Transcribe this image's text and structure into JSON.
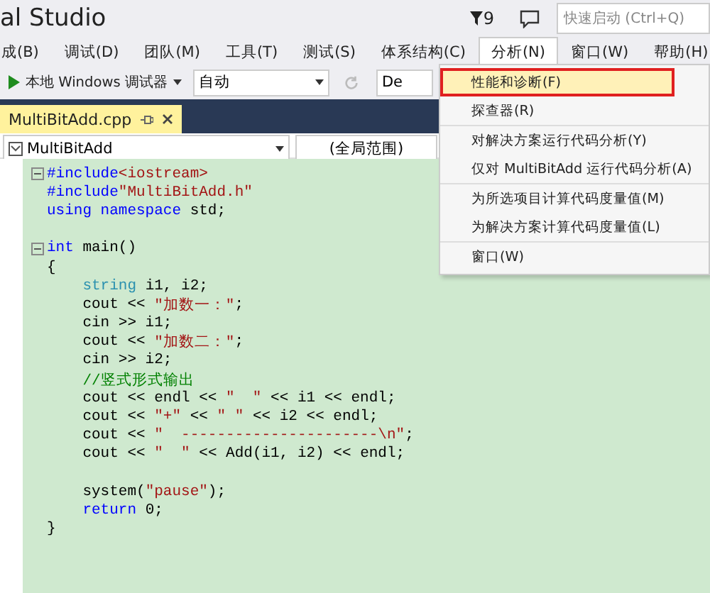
{
  "window": {
    "title": "al Studio",
    "notification_count": "9",
    "quick_launch": {
      "placeholder": "快速启动 (Ctrl+Q)"
    }
  },
  "menu_bar": [
    {
      "label": "成(B)",
      "selected": false
    },
    {
      "label": "调试(D)",
      "selected": false
    },
    {
      "label": "团队(M)",
      "selected": false
    },
    {
      "label": "工具(T)",
      "selected": false
    },
    {
      "label": "测试(S)",
      "selected": false
    },
    {
      "label": "体系结构(C)",
      "selected": false
    },
    {
      "label": "分析(N)",
      "selected": true
    },
    {
      "label": "窗口(W)",
      "selected": false
    },
    {
      "label": "帮助(H)",
      "selected": false
    }
  ],
  "toolbar": {
    "run_label": "本地 Windows 调试器",
    "config": "自动",
    "platform": "De"
  },
  "document_tab": {
    "title": "MultiBitAdd.cpp",
    "selected": true
  },
  "nav_bar": {
    "scope": "MultiBitAdd",
    "member": "(全局范围)"
  },
  "code_lines": [
    {
      "kind": "fold_start",
      "segments": [
        {
          "kind": "keyword",
          "text": "#include"
        },
        {
          "kind": "string",
          "text": "<iostream>"
        }
      ]
    },
    {
      "kind": "code",
      "segments": [
        {
          "kind": "keyword",
          "text": "#include"
        },
        {
          "kind": "string",
          "text": "\"MultiBitAdd.h\""
        }
      ]
    },
    {
      "kind": "code",
      "segments": [
        {
          "kind": "keyword",
          "text": "using namespace"
        },
        {
          "kind": "plain",
          "text": " std;"
        }
      ]
    },
    {
      "kind": "blank"
    },
    {
      "kind": "fold_start",
      "segments": [
        {
          "kind": "keyword",
          "text": "int"
        },
        {
          "kind": "plain",
          "text": " main()"
        }
      ]
    },
    {
      "kind": "code",
      "segments": [
        {
          "kind": "plain",
          "text": "{"
        }
      ]
    },
    {
      "kind": "code",
      "segments": [
        {
          "kind": "type",
          "text": "    string"
        },
        {
          "kind": "plain",
          "text": " i1, i2;"
        }
      ]
    },
    {
      "kind": "code",
      "segments": [
        {
          "kind": "plain",
          "text": "    cout << "
        },
        {
          "kind": "string",
          "text": "\"加数一：\""
        },
        {
          "kind": "plain",
          "text": ";"
        }
      ]
    },
    {
      "kind": "code",
      "segments": [
        {
          "kind": "plain",
          "text": "    cin >> i1;"
        }
      ]
    },
    {
      "kind": "code",
      "segments": [
        {
          "kind": "plain",
          "text": "    cout << "
        },
        {
          "kind": "string",
          "text": "\"加数二：\""
        },
        {
          "kind": "plain",
          "text": ";"
        }
      ]
    },
    {
      "kind": "code",
      "segments": [
        {
          "kind": "plain",
          "text": "    cin >> i2;"
        }
      ]
    },
    {
      "kind": "code",
      "segments": [
        {
          "kind": "comment",
          "text": "    //竖式形式输出"
        }
      ]
    },
    {
      "kind": "code",
      "segments": [
        {
          "kind": "plain",
          "text": "    cout << endl << "
        },
        {
          "kind": "string",
          "text": "\"  \""
        },
        {
          "kind": "plain",
          "text": " << i1 << endl;"
        }
      ]
    },
    {
      "kind": "code",
      "segments": [
        {
          "kind": "plain",
          "text": "    cout << "
        },
        {
          "kind": "string",
          "text": "\"+\""
        },
        {
          "kind": "plain",
          "text": " << "
        },
        {
          "kind": "string",
          "text": "\" \""
        },
        {
          "kind": "plain",
          "text": " << i2 << endl;"
        }
      ]
    },
    {
      "kind": "code",
      "segments": [
        {
          "kind": "plain",
          "text": "    cout << "
        },
        {
          "kind": "string",
          "text": "\"  ----------------------\\n\""
        },
        {
          "kind": "plain",
          "text": ";"
        }
      ]
    },
    {
      "kind": "code",
      "segments": [
        {
          "kind": "plain",
          "text": "    cout << "
        },
        {
          "kind": "string",
          "text": "\"  \""
        },
        {
          "kind": "plain",
          "text": " << Add(i1, i2) << endl;"
        }
      ]
    },
    {
      "kind": "blank"
    },
    {
      "kind": "code",
      "segments": [
        {
          "kind": "plain",
          "text": "    system("
        },
        {
          "kind": "string",
          "text": "\"pause\""
        },
        {
          "kind": "plain",
          "text": ");"
        }
      ]
    },
    {
      "kind": "code",
      "segments": [
        {
          "kind": "keyword",
          "text": "    return"
        },
        {
          "kind": "plain",
          "text": " 0;"
        }
      ]
    },
    {
      "kind": "code",
      "segments": [
        {
          "kind": "plain",
          "text": "}"
        }
      ]
    }
  ],
  "dropdown_menu": [
    [
      {
        "label": "性能和诊断(F)",
        "selected": true
      },
      {
        "label": "探查器(R)",
        "selected": false
      }
    ],
    [
      {
        "label": "对解决方案运行代码分析(Y)",
        "selected": false
      },
      {
        "label": "仅对 MultiBitAdd 运行代码分析(A)",
        "selected": false
      }
    ],
    [
      {
        "label": "为所选项目计算代码度量值(M)",
        "selected": false
      },
      {
        "label": "为解决方案计算代码度量值(L)",
        "selected": false
      }
    ],
    [
      {
        "label": "窗口(W)",
        "selected": false
      }
    ]
  ]
}
